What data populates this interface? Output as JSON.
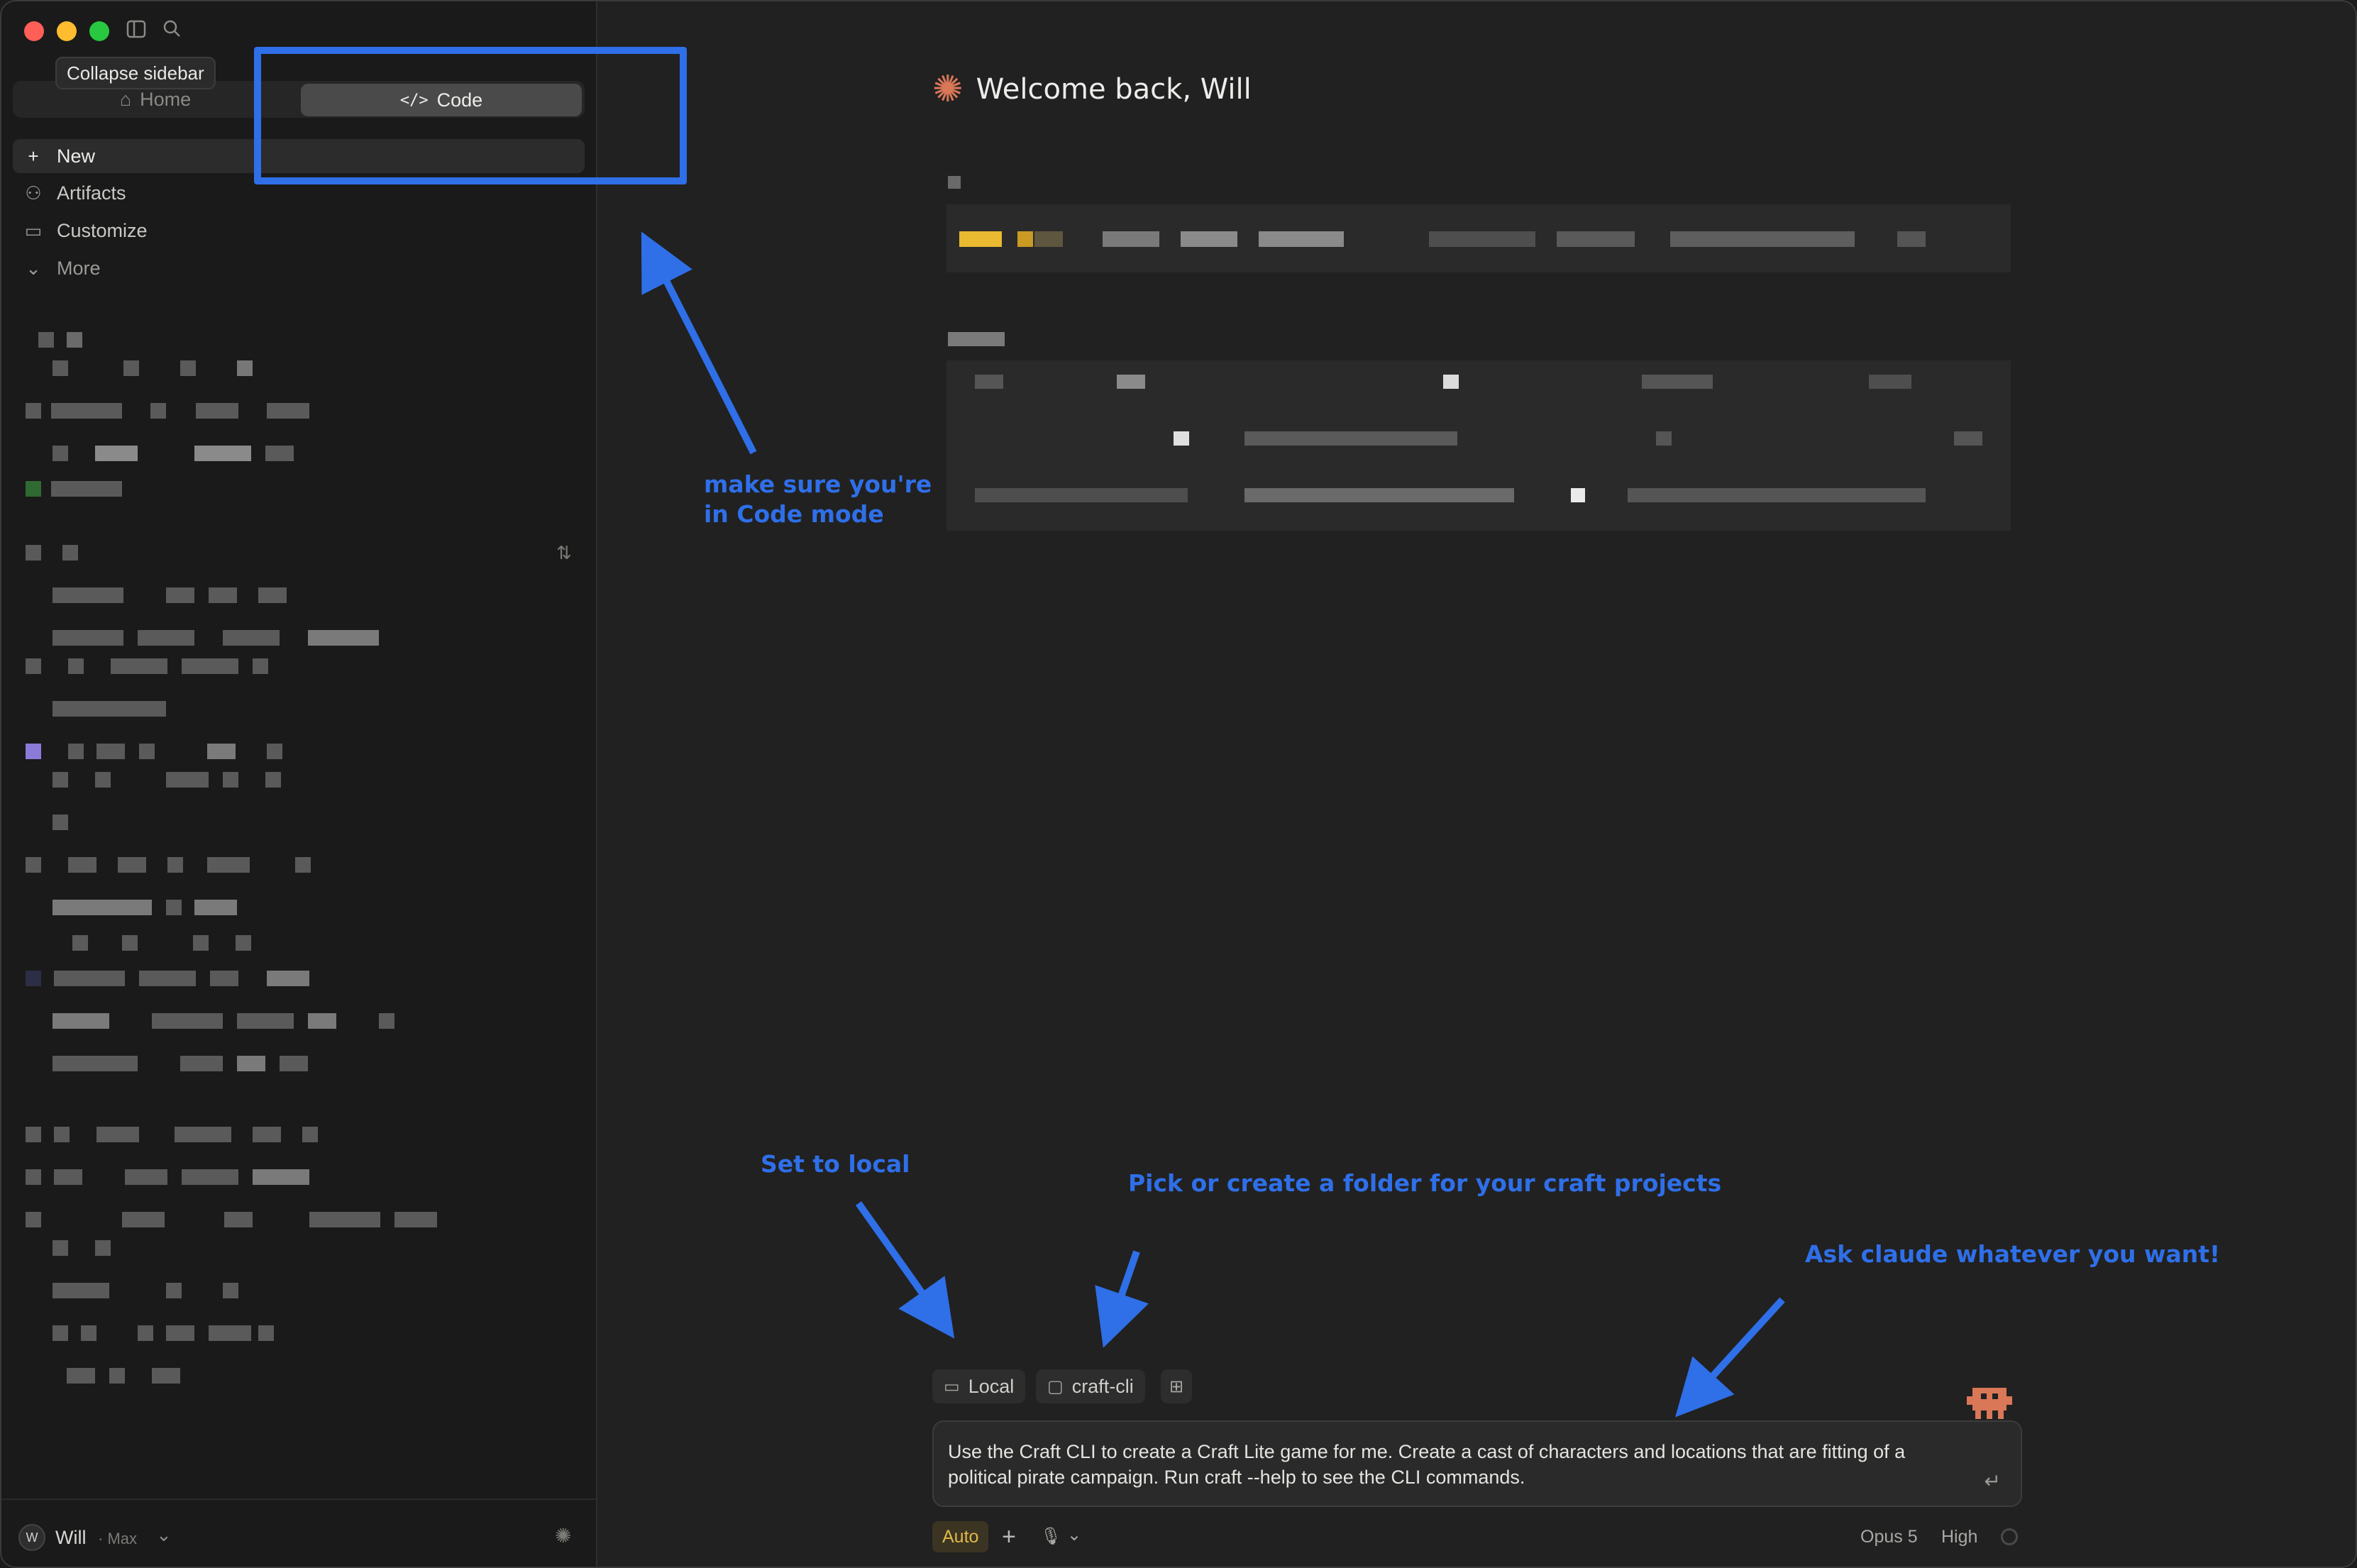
{
  "sidebar": {
    "tooltip": "Collapse sidebar",
    "modes": {
      "home": "Home",
      "code": "Code"
    },
    "nav": [
      {
        "label": "New",
        "icon": "plus-icon"
      },
      {
        "label": "Artifacts",
        "icon": "artifacts-icon"
      },
      {
        "label": "Customize",
        "icon": "briefcase-icon"
      },
      {
        "label": "More",
        "icon": "chevron-down-icon"
      }
    ],
    "user": {
      "initial": "W",
      "name": "Will",
      "plan": "· Max"
    }
  },
  "main": {
    "welcome": "Welcome back, Will"
  },
  "annotations": {
    "code_mode": "make sure you're in Code mode",
    "set_local": "Set to local",
    "pick_folder": "Pick or create a folder for your craft projects",
    "ask_claude": "Ask claude whatever you want!"
  },
  "composer": {
    "env_chip": "Local",
    "folder_chip": "craft-cli",
    "prompt": "Use the Craft CLI to create a Craft Lite game for me. Create a cast of characters and locations that are fitting of a political pirate campaign. Run craft --help to see the CLI commands.",
    "mode": "Auto",
    "model": "Opus 5",
    "effort": "High"
  },
  "colors": {
    "accent_annotation": "#2f6fe8",
    "brand_star": "#d97757",
    "auto_badge": "#e0b84a"
  }
}
